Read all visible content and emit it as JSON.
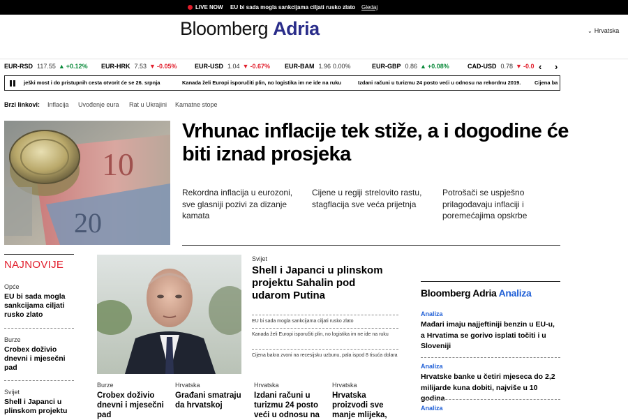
{
  "livebar": {
    "live_label": "LIVE NOW",
    "headline": "EU bi sada mogla sankcijama ciljati rusko zlato",
    "watch_label": "Gledaj"
  },
  "header": {
    "logo_part1": "Bloomberg",
    "logo_part2": "Adria",
    "region": "Hrvatska"
  },
  "ticker": [
    {
      "symbol": "EUR-RSD",
      "value": "117.55",
      "change": "+0.12%",
      "dir": "up"
    },
    {
      "symbol": "EUR-HRK",
      "value": "7.53",
      "change": "-0.05%",
      "dir": "down"
    },
    {
      "symbol": "EUR-USD",
      "value": "1.04",
      "change": "-0.67%",
      "dir": "down"
    },
    {
      "symbol": "EUR-BAM",
      "value": "1.96",
      "change": "0.00%",
      "dir": "flat"
    },
    {
      "symbol": "EUR-GBP",
      "value": "0.86",
      "change": "+0.08%",
      "dir": "up"
    },
    {
      "symbol": "CAD-USD",
      "value": "0.78",
      "change": "-0.0",
      "dir": "down"
    }
  ],
  "crawler": [
    "ješki most i do pristupnih cesta otvorit će se 26. srpnja",
    "Kanada želi Europi isporučiti plin, no logistika im ne ide na ruku",
    "Izdani računi u turizmu 24 posto veći u odnosu na rekordnu 2019.",
    "Cijena ba"
  ],
  "quick_links": {
    "label": "Brzi linkovi:",
    "items": [
      "Inflacija",
      "Uvođenje eura",
      "Rat u Ukrajini",
      "Kamatne stope"
    ]
  },
  "hero": {
    "title": "Vrhunac inflacije tek stiže, a i dogodine će biti iznad prosjeka",
    "subs": [
      "Rekordna inflacija u eurozoni, sve glasniji pozivi za dizanje kamata",
      "Cijene u regiji strelovito rastu, stagflacija sve veća prijetnja",
      "Potrošači se uspješno prilagođavaju inflaciji i poremećajima opskrbe"
    ]
  },
  "najnovije": {
    "title": "NAJNOVIJE",
    "items": [
      {
        "cat": "Opće",
        "title": "EU bi sada mogla sankcijama ciljati rusko zlato"
      },
      {
        "cat": "Burze",
        "title": "Crobex doživio dnevni i mjesečni pad"
      },
      {
        "cat": "Svijet",
        "title": "Shell i Japanci u plinskom projektu"
      }
    ]
  },
  "center": {
    "cat": "Svijet",
    "title": "Shell i Japanci u plinskom projektu Sahalin pod udarom Putina",
    "related": [
      "EU bi sada mogla sankcijama ciljati rusko zlato",
      "Kanada želi Europi isporučiti plin, no logistika im ne ide na ruku",
      "Cijena bakra zvoni na recesijsku uzbunu, pala ispod 8 tisuća dolara"
    ]
  },
  "bottom": [
    {
      "cat": "Burze",
      "title": "Crobex doživio dnevni i mjesečni pad"
    },
    {
      "cat": "Hrvatska",
      "title": "Građani smatraju da hrvatskoj"
    },
    {
      "cat": "Hrvatska",
      "title": "Izdani računi u turizmu 24 posto veći u odnosu na"
    },
    {
      "cat": "Hrvatska",
      "title": "Hrvatska proizvodi sve manje mlijeka,"
    }
  ],
  "analiza": {
    "head1": "Bloomberg Adria",
    "head2": "Analiza",
    "items": [
      {
        "cat": "Analiza",
        "title": "Mađari imaju najjeftiniji benzin u EU-u, a Hrvatima se gorivo isplati točiti i u Sloveniji"
      },
      {
        "cat": "Analiza",
        "title": "Hrvatske banke u četiri mjeseca do 2,2 milijarde kuna dobiti, najviše u 10 godina"
      },
      {
        "cat": "Analiza",
        "title": ""
      }
    ]
  },
  "colors": {
    "accent_red": "#e11d2b",
    "brand_blue": "#2a2d8a",
    "link_blue": "#1f5fd6",
    "up_green": "#0a8a3a"
  }
}
